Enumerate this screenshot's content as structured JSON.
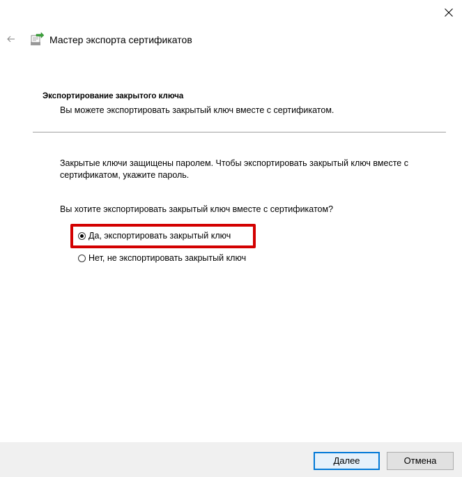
{
  "window": {
    "close_icon": "close-icon"
  },
  "header": {
    "back_icon": "back-arrow-icon",
    "wizard_icon": "certificate-export-wizard-icon",
    "title": "Мастер экспорта сертификатов"
  },
  "section": {
    "heading": "Экспортирование закрытого ключа",
    "subheading": "Вы можете экспортировать закрытый ключ вместе с сертификатом."
  },
  "content": {
    "description": "Закрытые ключи защищены паролем. Чтобы экспортировать закрытый ключ вместе с сертификатом, укажите пароль.",
    "question": "Вы хотите экспортировать закрытый ключ вместе с сертификатом?",
    "options": [
      {
        "label": "Да, экспортировать закрытый ключ",
        "selected": true
      },
      {
        "label": "Нет, не экспортировать закрытый ключ",
        "selected": false
      }
    ],
    "highlight_color": "#d30000"
  },
  "footer": {
    "next_label": "Далее",
    "cancel_label": "Отмена"
  },
  "colors": {
    "accent": "#0078d7",
    "footer_bg": "#f0f0f0",
    "separator": "#a0a0a0"
  }
}
